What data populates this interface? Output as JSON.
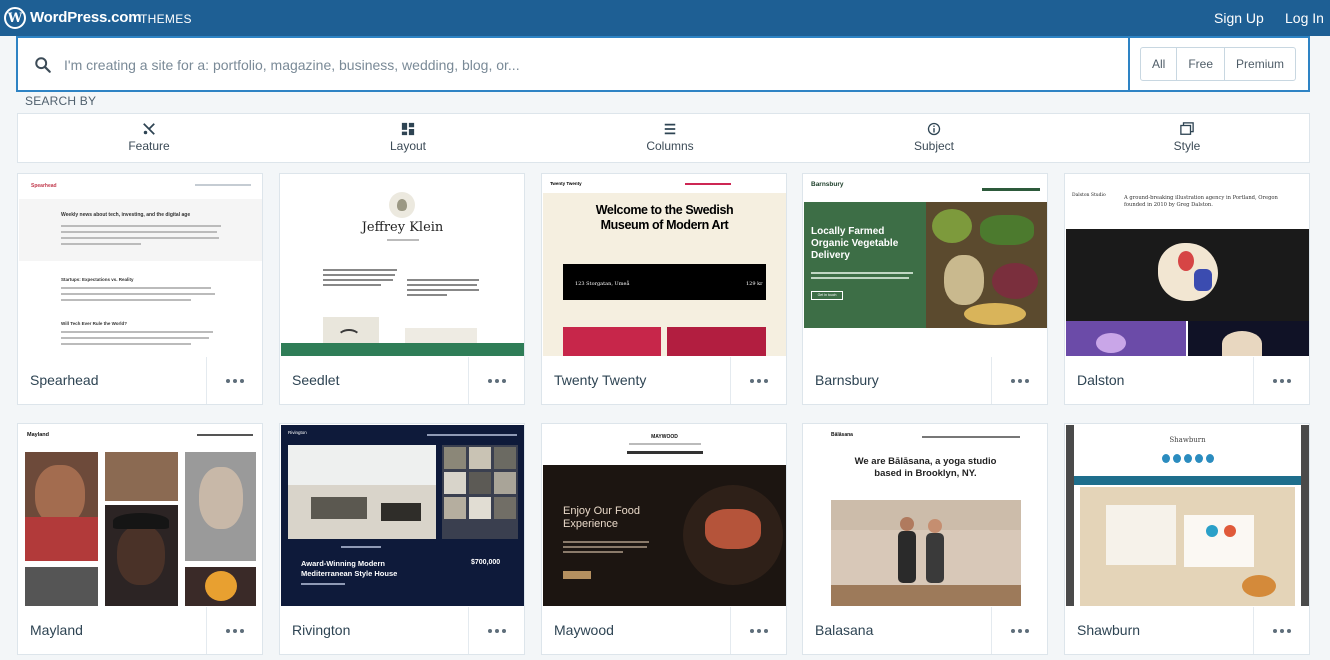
{
  "header": {
    "brand": "WordPress.com",
    "section": "THEMES",
    "signup": "Sign Up",
    "login": "Log In",
    "logo_letter": "W"
  },
  "search": {
    "placeholder": "I'm creating a site for a: portfolio, magazine, business, wedding, blog, or...",
    "filters": [
      "All",
      "Free",
      "Premium"
    ]
  },
  "search_by": {
    "label": "SEARCH BY",
    "items": [
      {
        "label": "Feature",
        "icon": "tools-icon"
      },
      {
        "label": "Layout",
        "icon": "layout-icon"
      },
      {
        "label": "Columns",
        "icon": "columns-icon"
      },
      {
        "label": "Subject",
        "icon": "info-icon"
      },
      {
        "label": "Style",
        "icon": "style-icon"
      }
    ]
  },
  "themes": [
    {
      "name": "Spearhead"
    },
    {
      "name": "Seedlet"
    },
    {
      "name": "Twenty Twenty"
    },
    {
      "name": "Barnsbury"
    },
    {
      "name": "Dalston"
    },
    {
      "name": "Mayland"
    },
    {
      "name": "Rivington"
    },
    {
      "name": "Maywood"
    },
    {
      "name": "Balasana"
    },
    {
      "name": "Shawburn"
    }
  ],
  "previews": {
    "spearhead": {
      "logo": "Spearhead",
      "heading": "Weekly news about tech, investing, and the digital age",
      "post1": "Startups: Expectations vs. Reality",
      "post2": "Will Tech Ever Rule the World?"
    },
    "seedlet": {
      "title": "Jeffrey Klein"
    },
    "twenty_twenty": {
      "logo": "Twenty Twenty",
      "heading_line1": "Welcome to the Swedish",
      "heading_line2": "Museum of Modern Art",
      "address": "123 Storgatan, Umeå",
      "price": "129 kr"
    },
    "barnsbury": {
      "logo": "Barnsbury",
      "heading": "Locally Farmed Organic Vegetable Delivery",
      "cta": "Get in touch"
    },
    "dalston": {
      "logo": "Dalston Studio",
      "intro": "A ground-breaking illustration agency in Portland, Oregon founded in 2010 by Greg Dalston."
    },
    "mayland": {
      "logo": "Mayland"
    },
    "rivington": {
      "logo": "Rivington",
      "heading_line1": "Award-Winning Modern",
      "heading_line2": "Mediterranean Style House",
      "price": "$700,000"
    },
    "maywood": {
      "logo": "MAYWOOD",
      "heading_line1": "Enjoy Our Food",
      "heading_line2": "Experience"
    },
    "balasana": {
      "logo": "Bālāsana",
      "heading_line1": "We are Bālāsana, a yoga studio",
      "heading_line2": "based in Brooklyn, NY."
    },
    "shawburn": {
      "logo": "Shawburn"
    }
  },
  "colors": {
    "masterbar": "#1e5f94",
    "accent": "#2e83c4",
    "barnsbury_green": "#3d6e46",
    "rivington_navy": "#0e1a3a"
  }
}
